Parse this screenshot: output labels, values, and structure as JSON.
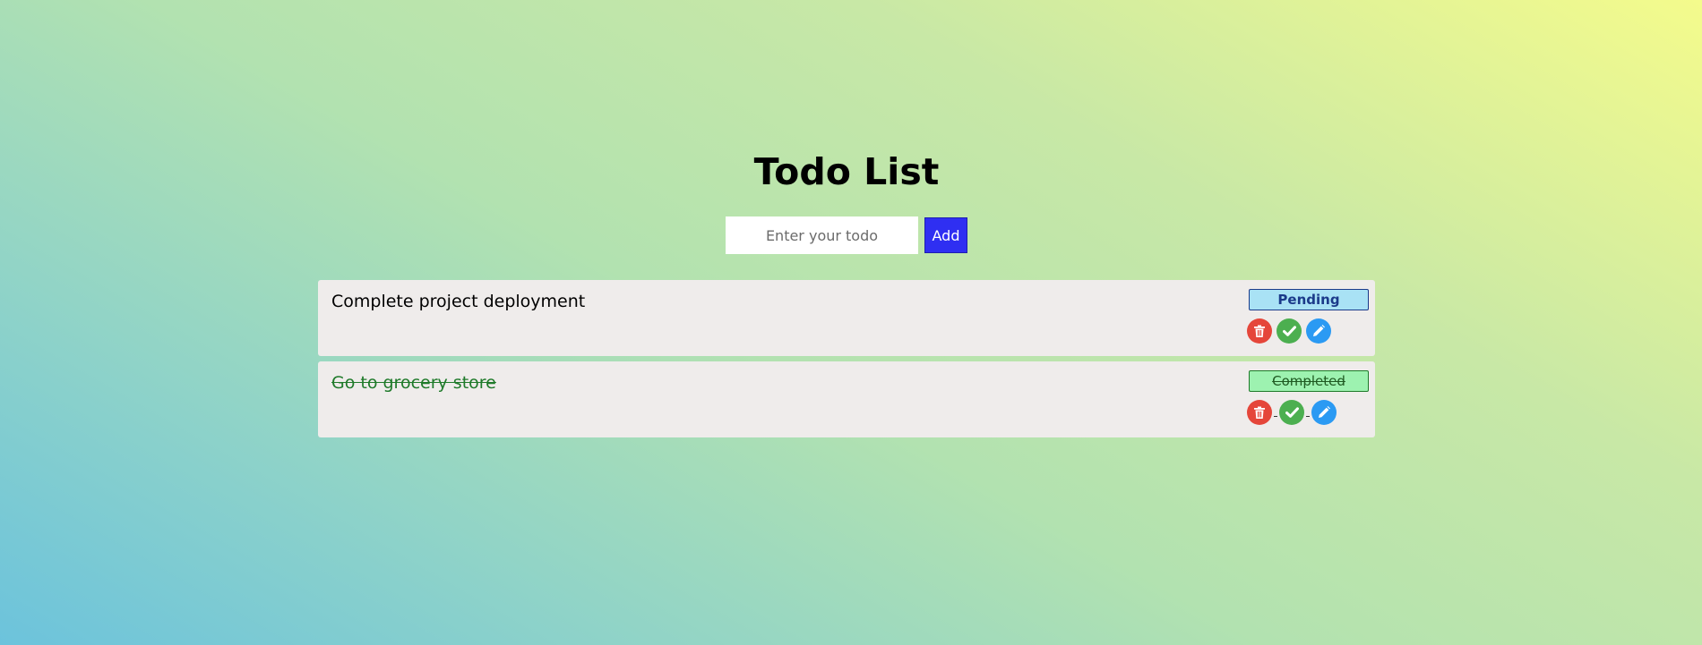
{
  "header": {
    "title": "Todo List"
  },
  "form": {
    "input_value": "",
    "input_placeholder": "Enter your todo",
    "add_label": "Add"
  },
  "todos": [
    {
      "text": "Complete project deployment",
      "status": "Pending",
      "completed": false
    },
    {
      "text": "Go to grocery store",
      "status": "Completed",
      "completed": true
    }
  ],
  "icons": {
    "delete": "trash-icon",
    "complete": "check-icon",
    "edit": "pencil-icon"
  },
  "colors": {
    "add_button": "#2f2ff2",
    "delete": "#e5463a",
    "complete": "#4caf50",
    "edit": "#2b9af3",
    "pending_badge": "#a9e2f5",
    "completed_badge": "#9df2b0",
    "completed_text": "#1f7a2a"
  }
}
